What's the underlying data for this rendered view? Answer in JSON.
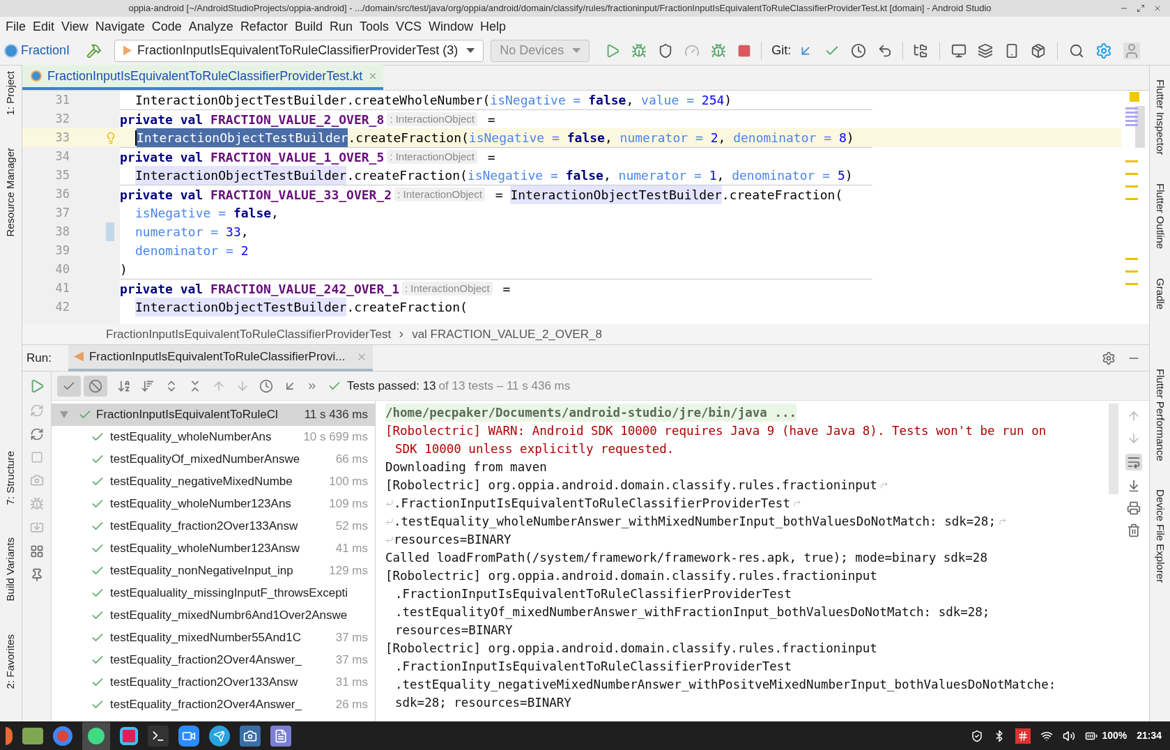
{
  "window": {
    "title": "oppia-android [~/AndroidStudioProjects/oppia-android] - .../domain/src/test/java/org/oppia/android/domain/classify/rules/fractioninput/FractionInputIsEquivalentToRuleClassifierProviderTest.kt [domain] - Android Studio"
  },
  "menu": [
    "File",
    "Edit",
    "View",
    "Navigate",
    "Code",
    "Analyze",
    "Refactor",
    "Build",
    "Run",
    "Tools",
    "VCS",
    "Window",
    "Help"
  ],
  "toolbar": {
    "project_name": "FractionI",
    "run_config": "FractionInputIsEquivalentToRuleClassifierProviderTest (3)",
    "device": {
      "label": "No Devices",
      "disabled": true
    },
    "git_label": "Git:"
  },
  "left_tool_windows": [
    "1: Project",
    "Resource Manager"
  ],
  "left_tool_windows_bottom": [
    "7: Structure",
    "Build Variants",
    "2: Favorites"
  ],
  "right_tool_windows": [
    "Flutter Inspector",
    "Flutter Outline",
    "Gradle",
    "Flutter Performance",
    "Device File Explorer"
  ],
  "editor_tabs": [
    {
      "label": "FractionInputIsEquivalentToRuleClassifierProviderTest.kt",
      "selected": true
    }
  ],
  "editor": {
    "lines": [
      {
        "number": "31",
        "kind": "continuation",
        "separator_above": false,
        "current": false,
        "changed": false,
        "tokens": [
          {
            "t": "InteractionObjectTestBuilder",
            "kind": "plain"
          },
          {
            "t": ".createWholeNumber(",
            "kind": "plain"
          },
          {
            "t": "isNegative = ",
            "kind": "param"
          },
          {
            "t": "false",
            "kind": "keyword"
          },
          {
            "t": ", ",
            "kind": "plain"
          },
          {
            "t": "value = ",
            "kind": "param"
          },
          {
            "t": "254",
            "kind": "number"
          },
          {
            "t": ")",
            "kind": "plain"
          }
        ]
      },
      {
        "number": "32",
        "kind": "declaration",
        "separator_above": true,
        "current": false,
        "changed": false,
        "tokens": [
          {
            "t": "private val ",
            "kind": "keyword"
          },
          {
            "t": "FRACTION_VALUE_2_OVER_8",
            "kind": "constant"
          },
          {
            "t": ": InteractionObject",
            "kind": "hint"
          },
          {
            "t": " =",
            "kind": "plain"
          }
        ]
      },
      {
        "number": "33",
        "kind": "continuation",
        "separator_above": false,
        "current": true,
        "changed": false,
        "tokens": [
          {
            "t": "InteractionObjectTestBuilder",
            "kind": "selection"
          },
          {
            "t": ".createFraction(",
            "kind": "plain"
          },
          {
            "t": "isNegative = ",
            "kind": "param"
          },
          {
            "t": "false",
            "kind": "keyword"
          },
          {
            "t": ", ",
            "kind": "plain"
          },
          {
            "t": "numerator = ",
            "kind": "param"
          },
          {
            "t": "2",
            "kind": "number"
          },
          {
            "t": ", ",
            "kind": "plain"
          },
          {
            "t": "denominator = ",
            "kind": "param"
          },
          {
            "t": "8",
            "kind": "number"
          },
          {
            "t": ")",
            "kind": "plain"
          }
        ]
      },
      {
        "number": "34",
        "kind": "declaration",
        "separator_above": true,
        "current": false,
        "changed": false,
        "tokens": [
          {
            "t": "private val ",
            "kind": "keyword"
          },
          {
            "t": "FRACTION_VALUE_1_OVER_5",
            "kind": "constant"
          },
          {
            "t": ": InteractionObject",
            "kind": "hint"
          },
          {
            "t": " =",
            "kind": "plain"
          }
        ]
      },
      {
        "number": "35",
        "kind": "continuation",
        "separator_above": false,
        "current": false,
        "changed": false,
        "tokens": [
          {
            "t": "InteractionObjectTestBuilder",
            "kind": "usage"
          },
          {
            "t": ".createFraction(",
            "kind": "plain"
          },
          {
            "t": "isNegative = ",
            "kind": "param"
          },
          {
            "t": "false",
            "kind": "keyword"
          },
          {
            "t": ", ",
            "kind": "plain"
          },
          {
            "t": "numerator = ",
            "kind": "param"
          },
          {
            "t": "1",
            "kind": "number"
          },
          {
            "t": ", ",
            "kind": "plain"
          },
          {
            "t": "denominator = ",
            "kind": "param"
          },
          {
            "t": "5",
            "kind": "number"
          },
          {
            "t": ")",
            "kind": "plain"
          }
        ]
      },
      {
        "number": "36",
        "kind": "declaration",
        "separator_above": true,
        "current": false,
        "changed": false,
        "tokens": [
          {
            "t": "private val ",
            "kind": "keyword"
          },
          {
            "t": "FRACTION_VALUE_33_OVER_2",
            "kind": "constant"
          },
          {
            "t": ": InteractionObject",
            "kind": "hint"
          },
          {
            "t": " = ",
            "kind": "plain"
          },
          {
            "t": "InteractionObjectTestBuilder",
            "kind": "usage"
          },
          {
            "t": ".createFraction(",
            "kind": "plain"
          }
        ]
      },
      {
        "number": "37",
        "kind": "continuation",
        "separator_above": false,
        "current": false,
        "changed": false,
        "tokens": [
          {
            "t": "isNegative = ",
            "kind": "param"
          },
          {
            "t": "false",
            "kind": "keyword"
          },
          {
            "t": ",",
            "kind": "plain"
          }
        ]
      },
      {
        "number": "38",
        "kind": "continuation",
        "separator_above": false,
        "current": false,
        "changed": true,
        "tokens": [
          {
            "t": "numerator = ",
            "kind": "param"
          },
          {
            "t": "33",
            "kind": "number"
          },
          {
            "t": ",",
            "kind": "plain"
          }
        ]
      },
      {
        "number": "39",
        "kind": "continuation",
        "separator_above": false,
        "current": false,
        "changed": false,
        "tokens": [
          {
            "t": "denominator = ",
            "kind": "param"
          },
          {
            "t": "2",
            "kind": "number"
          }
        ]
      },
      {
        "number": "40",
        "kind": "declaration",
        "separator_above": false,
        "current": false,
        "changed": false,
        "tokens": [
          {
            "t": ")",
            "kind": "plain"
          }
        ]
      },
      {
        "number": "41",
        "kind": "declaration",
        "separator_above": true,
        "current": false,
        "changed": false,
        "tokens": [
          {
            "t": "private val ",
            "kind": "keyword"
          },
          {
            "t": "FRACTION_VALUE_242_OVER_1",
            "kind": "constant"
          },
          {
            "t": ": InteractionObject",
            "kind": "hint"
          },
          {
            "t": " =",
            "kind": "plain"
          }
        ]
      },
      {
        "number": "42",
        "kind": "continuation",
        "separator_above": false,
        "current": false,
        "changed": false,
        "tokens": [
          {
            "t": "InteractionObjectTestBuilder",
            "kind": "usage"
          },
          {
            "t": ".createFraction(",
            "kind": "plain"
          }
        ]
      }
    ]
  },
  "breadcrumbs": [
    "FractionInputIsEquivalentToRuleClassifierProviderTest",
    "val FRACTION_VALUE_2_OVER_8"
  ],
  "run_panel": {
    "label": "Run:",
    "tabs": [
      {
        "label": "FractionInputIsEquivalentToRuleClassifierProvi...",
        "selected": true
      }
    ],
    "show_passed": {
      "selected": true
    },
    "show_ignored": {
      "selected": true
    },
    "status": {
      "passed": "Tests passed: 13",
      "detail": "of 13 tests – 11 s 436 ms"
    },
    "tree": {
      "name": "FractionInputIsEquivalentToRuleCl",
      "time": "11 s 436 ms",
      "passed": true,
      "expanded": true,
      "selected": true,
      "children": [
        {
          "name": "testEquality_wholeNumberAns",
          "time": "10 s 699 ms",
          "passed": true,
          "selected": false
        },
        {
          "name": "testEqualityOf_mixedNumberAnswe",
          "time": "66 ms",
          "passed": true,
          "selected": false
        },
        {
          "name": "testEquality_negativeMixedNumbe",
          "time": "100 ms",
          "passed": true,
          "selected": false
        },
        {
          "name": "testEquality_wholeNumber123Ans",
          "time": "109 ms",
          "passed": true,
          "selected": false
        },
        {
          "name": "testEquality_fraction2Over133Answ",
          "time": "52 ms",
          "passed": true,
          "selected": false
        },
        {
          "name": "testEquality_wholeNumber123Answ",
          "time": "41 ms",
          "passed": true,
          "selected": false
        },
        {
          "name": "testEquality_nonNegativeInput_inp",
          "time": "129 ms",
          "passed": true,
          "selected": false
        },
        {
          "name": "testEqualuality_missingInputF_throwsExcepti",
          "passed": true,
          "selected": false
        },
        {
          "name": "testEquality_mixedNumbr6And1Over2Answe",
          "passed": true,
          "selected": false
        },
        {
          "name": "testEquality_mixedNumber55And1C",
          "time": "37 ms",
          "passed": true,
          "selected": false
        },
        {
          "name": "testEquality_fraction2Over4Answer_",
          "time": "37 ms",
          "passed": true,
          "selected": false
        },
        {
          "name": "testEquality_fraction2Over133Answ",
          "time": "31 ms",
          "passed": true,
          "selected": false
        },
        {
          "name": "testEquality_fraction2Over4Answer_",
          "time": "26 ms",
          "passed": true,
          "selected": false
        }
      ]
    },
    "console": [
      {
        "text": "/home/pecpaker/Documents/android-studio/jre/bin/java ...",
        "kind": "command",
        "indented": false,
        "wrap_start": false,
        "wrap_end": false
      },
      {
        "text": "[Robolectric] WARN: Android SDK 10000 requires Java 9 (have Java 8). Tests won't be run on",
        "kind": "warning",
        "indented": false,
        "wrap_start": false,
        "wrap_end": false
      },
      {
        "text": "SDK 10000 unless explicitly requested.",
        "kind": "warning",
        "indented": true,
        "wrap_start": false,
        "wrap_end": false
      },
      {
        "text": "Downloading from maven",
        "kind": "output",
        "indented": false,
        "wrap_start": false,
        "wrap_end": false
      },
      {
        "text": "[Robolectric] org.oppia.android.domain.classify.rules.fractioninput",
        "kind": "output",
        "indented": false,
        "wrap_start": false,
        "wrap_end": true
      },
      {
        "text": ".FractionInputIsEquivalentToRuleClassifierProviderTest",
        "kind": "output",
        "indented": false,
        "wrap_start": true,
        "wrap_end": true
      },
      {
        "text": ".testEquality_wholeNumberAnswer_withMixedNumberInput_bothValuesDoNotMatch: sdk=28;",
        "kind": "output",
        "indented": false,
        "wrap_start": true,
        "wrap_end": true
      },
      {
        "text": "resources=BINARY",
        "kind": "output",
        "indented": false,
        "wrap_start": true,
        "wrap_end": false
      },
      {
        "text": "Called loadFromPath(/system/framework/framework-res.apk, true); mode=binary sdk=28",
        "kind": "output",
        "indented": false,
        "wrap_start": false,
        "wrap_end": false
      },
      {
        "text": "[Robolectric] org.oppia.android.domain.classify.rules.fractioninput",
        "kind": "output",
        "indented": false,
        "wrap_start": false,
        "wrap_end": false
      },
      {
        "text": ".FractionInputIsEquivalentToRuleClassifierProviderTest",
        "kind": "output",
        "indented": true,
        "wrap_start": false,
        "wrap_end": false
      },
      {
        "text": ".testEqualityOf_mixedNumberAnswer_withFractionInput_bothValuesDoNotMatch: sdk=28;",
        "kind": "output",
        "indented": true,
        "wrap_start": false,
        "wrap_end": false
      },
      {
        "text": "resources=BINARY",
        "kind": "output",
        "indented": true,
        "wrap_start": false,
        "wrap_end": false
      },
      {
        "text": "[Robolectric] org.oppia.android.domain.classify.rules.fractioninput",
        "kind": "output",
        "indented": false,
        "wrap_start": false,
        "wrap_end": false
      },
      {
        "text": ".FractionInputIsEquivalentToRuleClassifierProviderTest",
        "kind": "output",
        "indented": true,
        "wrap_start": false,
        "wrap_end": false
      },
      {
        "text": ".testEquality_negativeMixedNumberAnswer_withPositveMixedNumberInput_bothValuesDoNotMatche:",
        "kind": "output",
        "indented": true,
        "wrap_start": false,
        "wrap_end": false
      },
      {
        "text": "sdk=28; resources=BINARY",
        "kind": "output",
        "indented": true,
        "wrap_start": false,
        "wrap_end": false
      }
    ]
  },
  "taskbar": {
    "battery": "100%",
    "clock": "21:34"
  }
}
